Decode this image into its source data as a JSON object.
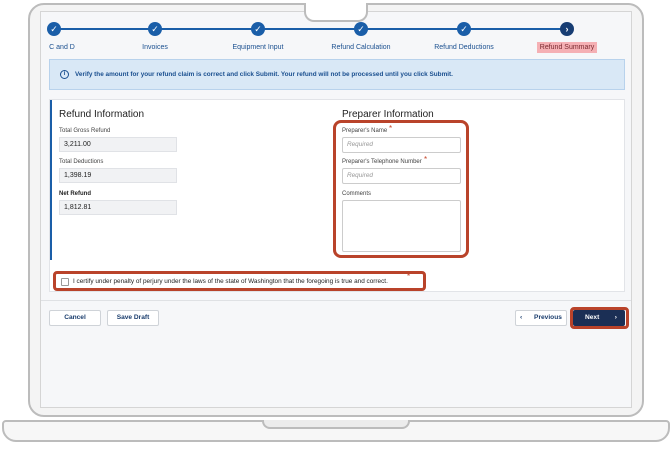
{
  "stepper": {
    "steps": [
      {
        "label": "C and D"
      },
      {
        "label": "Invoices"
      },
      {
        "label": "Equipment Input"
      },
      {
        "label": "Refund Calculation"
      },
      {
        "label": "Refund Deductions"
      },
      {
        "label": "Refund Summary"
      }
    ],
    "check_glyph": "✓",
    "current_glyph": "›"
  },
  "banner": {
    "icon": "i",
    "text": "Verify the amount for your refund claim is correct and click Submit. Your refund will not be processed until you click Submit."
  },
  "refund": {
    "title": "Refund Information",
    "gross_label": "Total Gross Refund",
    "gross_value": "3,211.00",
    "deductions_label": "Total Deductions",
    "deductions_value": "1,398.19",
    "net_label": "Net Refund",
    "net_value": "1,812.81"
  },
  "preparer": {
    "title": "Preparer Information",
    "name_label": "Preparer's Name",
    "name_placeholder": "Required",
    "phone_label": "Preparer's Telephone Number",
    "phone_placeholder": "Required",
    "comments_label": "Comments",
    "required_mark": "*"
  },
  "certify": {
    "text": "I certify under penalty of perjury under the laws of the state of Washington that the foregoing is true and correct.",
    "required_mark": "*"
  },
  "footer": {
    "cancel_label": "Cancel",
    "save_label": "Save Draft",
    "previous_label": "Previous",
    "previous_glyph": "‹",
    "next_label": "Next",
    "next_glyph": "›"
  },
  "colors": {
    "accent": "#1a5ea8",
    "highlight": "#b9432a",
    "next_button": "#1b2f55"
  }
}
